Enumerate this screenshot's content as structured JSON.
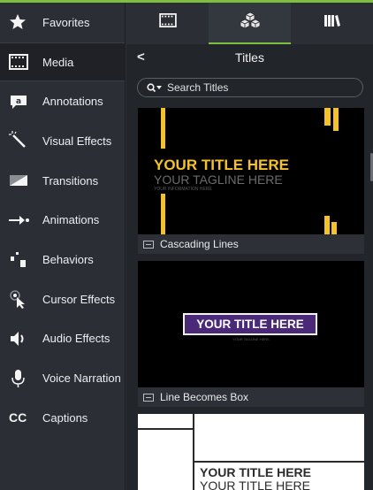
{
  "sidebar": {
    "items": [
      {
        "label": "Favorites",
        "icon": "star-icon"
      },
      {
        "label": "Media",
        "icon": "film-icon"
      },
      {
        "label": "Annotations",
        "icon": "annotation-icon"
      },
      {
        "label": "Visual Effects",
        "icon": "magic-wand-icon"
      },
      {
        "label": "Transitions",
        "icon": "transition-icon"
      },
      {
        "label": "Animations",
        "icon": "animation-arrow-icon"
      },
      {
        "label": "Behaviors",
        "icon": "behaviors-icon"
      },
      {
        "label": "Cursor Effects",
        "icon": "cursor-icon"
      },
      {
        "label": "Audio Effects",
        "icon": "speaker-icon"
      },
      {
        "label": "Voice Narration",
        "icon": "microphone-icon"
      },
      {
        "label": "Captions",
        "icon": "cc-icon",
        "icon_text": "CC"
      }
    ],
    "active": "Media"
  },
  "tabs": [
    {
      "icon": "film-icon"
    },
    {
      "icon": "cubes-icon",
      "active": true
    },
    {
      "icon": "library-icon"
    }
  ],
  "panel": {
    "back_label": "<",
    "title": "Titles",
    "search_placeholder": "Search Titles"
  },
  "cards": [
    {
      "name": "Cascading Lines",
      "title": "YOUR TITLE HERE",
      "tagline": "YOUR TAGLINE HERE",
      "info": "YOUR INFORMATION HERE"
    },
    {
      "name": "Line Becomes Box",
      "title": "YOUR TITLE HERE",
      "tagline": "YOUR TAGLINE HERE"
    },
    {
      "title_line1": "YOUR TITLE HERE",
      "title_line2": "YOUR TITLE HERE"
    }
  ],
  "colors": {
    "accent": "#7fbf3f",
    "title_yellow": "#f6c229",
    "box_purple": "#4a2a78"
  }
}
